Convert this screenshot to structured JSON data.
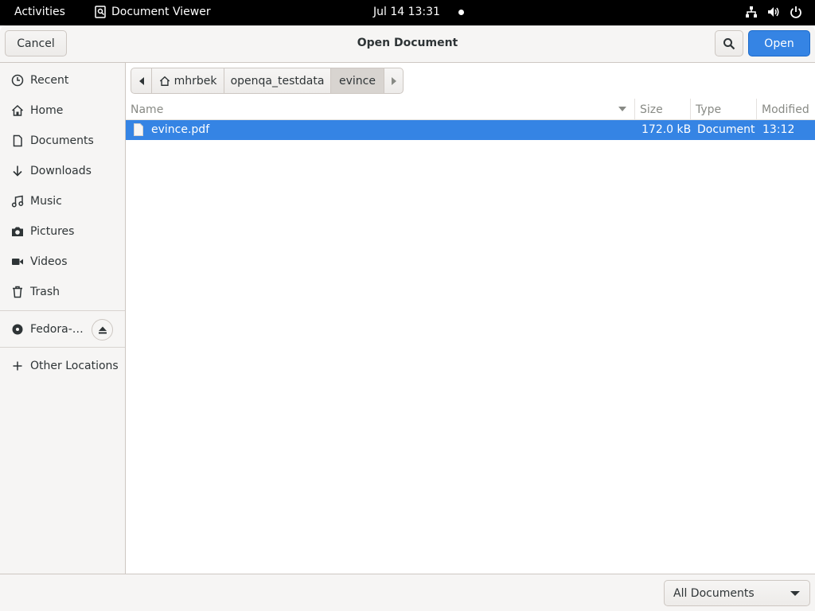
{
  "topbar": {
    "activities": "Activities",
    "app_name": "Document Viewer",
    "clock": "Jul 14  13:31",
    "status_icons": [
      "network-icon",
      "volume-icon",
      "power-icon"
    ]
  },
  "dialog": {
    "title": "Open Document",
    "cancel_label": "Cancel",
    "open_label": "Open",
    "accent": "#3584e4"
  },
  "sidebar": {
    "items": [
      {
        "label": "Recent",
        "icon": "clock-icon"
      },
      {
        "label": "Home",
        "icon": "home-icon"
      },
      {
        "label": "Documents",
        "icon": "document-icon"
      },
      {
        "label": "Downloads",
        "icon": "download-icon"
      },
      {
        "label": "Music",
        "icon": "music-icon"
      },
      {
        "label": "Pictures",
        "icon": "camera-icon"
      },
      {
        "label": "Videos",
        "icon": "video-icon"
      },
      {
        "label": "Trash",
        "icon": "trash-icon"
      }
    ],
    "devices": [
      {
        "label": "Fedora-…",
        "icon": "disc-icon"
      }
    ],
    "other": {
      "label": "Other Locations",
      "icon": "plus-icon"
    }
  },
  "pathbar": {
    "segments": [
      "mhrbek",
      "openqa_testdata",
      "evince"
    ],
    "current": "evince"
  },
  "filelist": {
    "columns": {
      "name": "Name",
      "size": "Size",
      "type": "Type",
      "modified": "Modified"
    },
    "rows": [
      {
        "name": "evince.pdf",
        "size": "172.0 kB",
        "type": "Document",
        "modified": "13:12",
        "selected": true
      }
    ]
  },
  "filter": {
    "selected": "All Documents"
  }
}
